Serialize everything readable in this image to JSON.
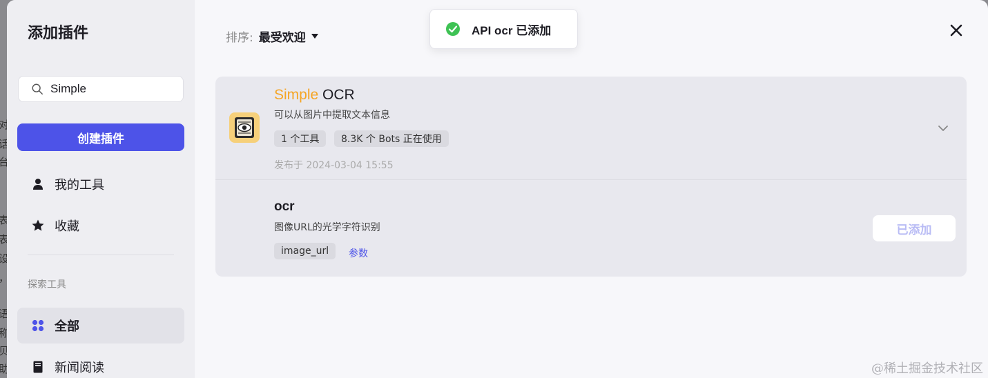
{
  "background_chars": [
    "对",
    "话",
    "台",
    "表",
    "表",
    "设",
    "，",
    "语",
    "称",
    "贝",
    "助"
  ],
  "sidebar": {
    "title": "添加插件",
    "search_value": "Simple",
    "create_button": "创建插件",
    "nav_items": [
      {
        "label": "我的工具",
        "icon": "user-icon"
      },
      {
        "label": "收藏",
        "icon": "star-icon"
      }
    ],
    "section_label": "探索工具",
    "explore_items": [
      {
        "label": "全部",
        "icon": "grid-icon",
        "active": true
      },
      {
        "label": "新闻阅读",
        "icon": "book-icon"
      }
    ]
  },
  "header": {
    "sort_label": "排序:",
    "sort_value": "最受欢迎"
  },
  "toast": {
    "message": "API ocr 已添加"
  },
  "plugin": {
    "name_highlight": "Simple",
    "name_rest": " OCR",
    "description": "可以从图片中提取文本信息",
    "tags": [
      "1 个工具",
      "8.3K 个 Bots 正在使用"
    ],
    "published": "发布于 2024-03-04 15:55",
    "tool": {
      "name": "ocr",
      "description": "图像URL的光学字符识别",
      "param_tag": "image_url",
      "params_link": "参数",
      "added_button": "已添加"
    }
  },
  "watermark": "@稀土掘金技术社区",
  "colors": {
    "accent": "#4d53e8",
    "highlight": "#f5a524",
    "success": "#3ec254"
  }
}
